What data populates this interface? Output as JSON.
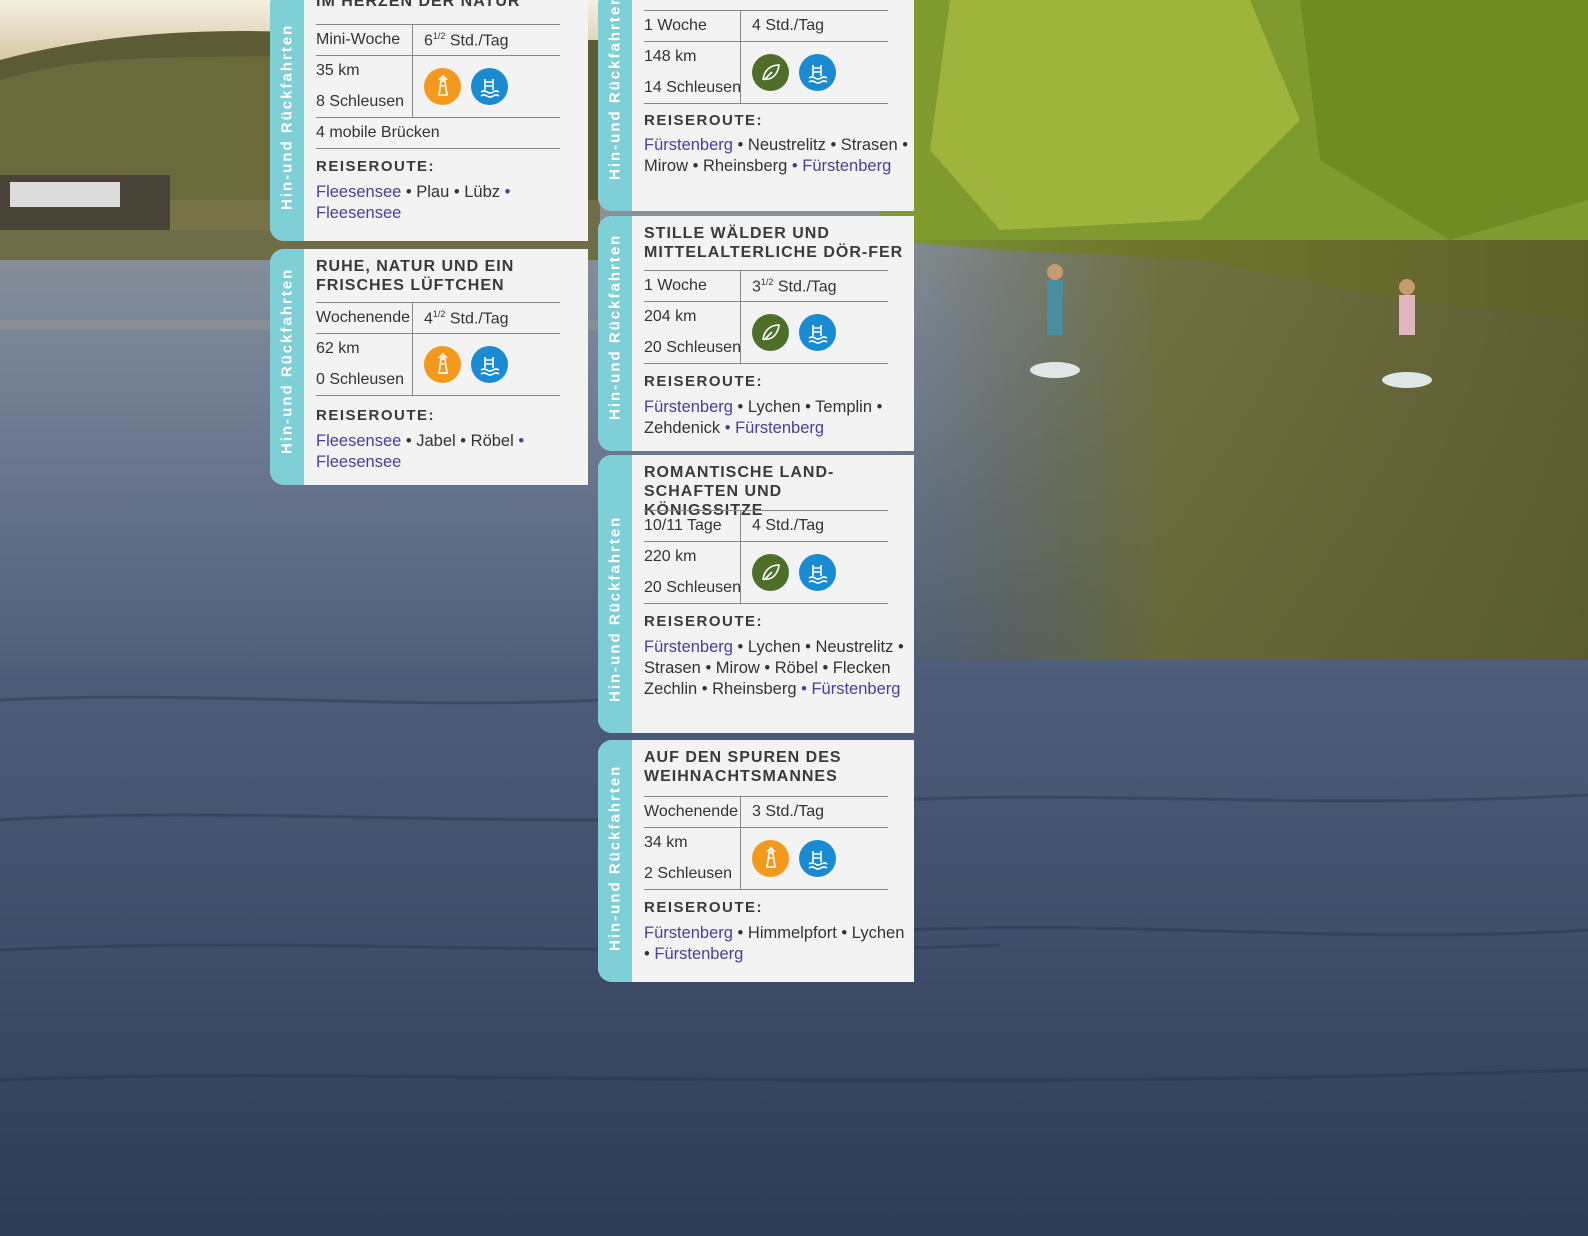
{
  "colors": {
    "strip": "#7ecfd6",
    "route_place": "#4a3f9a",
    "icon_orange": "#f39a1e",
    "icon_blue": "#1a8bd0",
    "icon_green": "#4e6e2a"
  },
  "strip_label": "Hin-und Rückfahrten",
  "route_label": "REISEROUTE:",
  "cards": [
    {
      "title": "IM HERZEN DER NATUR",
      "duration": "Mini-Woche",
      "hours_main": "6",
      "hours_frac": "1/2",
      "hours_unit": " Std./Tag",
      "distance": "35 km",
      "locks": "8 Schleusen",
      "extra": "4 mobile Brücken",
      "icons": [
        "lighthouse-icon",
        "swim-icon"
      ],
      "route": [
        "Fleesensee",
        " • Plau • Lübz ",
        "• Fleesensee"
      ]
    },
    {
      "title": "RUHE, NATUR UND EIN FRISCHES LÜFTCHEN",
      "duration": "Wochenende",
      "hours_main": "4",
      "hours_frac": "1/2",
      "hours_unit": " Std./Tag",
      "distance": "62 km",
      "locks": "0 Schleusen",
      "icons": [
        "lighthouse-icon",
        "swim-icon"
      ],
      "route": [
        "Fleesensee",
        " • Jabel • Röbel ",
        "• Fleesensee"
      ]
    },
    {
      "duration": "1 Woche",
      "hours_main": "4 Std./Tag",
      "distance": "148 km",
      "locks": "14 Schleusen",
      "icons": [
        "leaf-icon",
        "swim-icon"
      ],
      "route": [
        "Fürstenberg",
        " • Neustrelitz • Strasen • Mirow • Rheinsberg ",
        "• Fürstenberg"
      ]
    },
    {
      "title": "STILLE WÄLDER UND MITTELALTERLICHE DÖR-FER",
      "duration": "1 Woche",
      "hours_main": "3",
      "hours_frac": "1/2",
      "hours_unit": " Std./Tag",
      "distance": "204 km",
      "locks": "20 Schleusen",
      "icons": [
        "leaf-icon",
        "swim-icon"
      ],
      "route": [
        "Fürstenberg",
        " • Lychen • Templin • Zehdenick ",
        "• Fürstenberg"
      ]
    },
    {
      "title": "ROMANTISCHE LAND-SCHAFTEN UND KÖNIGSSITZE",
      "duration": "10/11 Tage",
      "hours_main": "4 Std./Tag",
      "distance": "220 km",
      "locks": "20 Schleusen",
      "icons": [
        "leaf-icon",
        "swim-icon"
      ],
      "route": [
        "Fürstenberg",
        " • Lychen • Neustrelitz • Strasen • Mirow • Röbel • Flecken Zechlin • Rheinsberg ",
        "• Fürstenberg"
      ]
    },
    {
      "title": "AUF DEN SPUREN DES WEIHNACHTSMANNES",
      "duration": "Wochenende",
      "hours_main": "3 Std./Tag",
      "distance": "34 km",
      "locks": "2 Schleusen",
      "icons": [
        "lighthouse-icon",
        "swim-icon"
      ],
      "route": [
        "Fürstenberg",
        " • Himmelpfort • Lychen • ",
        "Fürstenberg"
      ]
    }
  ]
}
